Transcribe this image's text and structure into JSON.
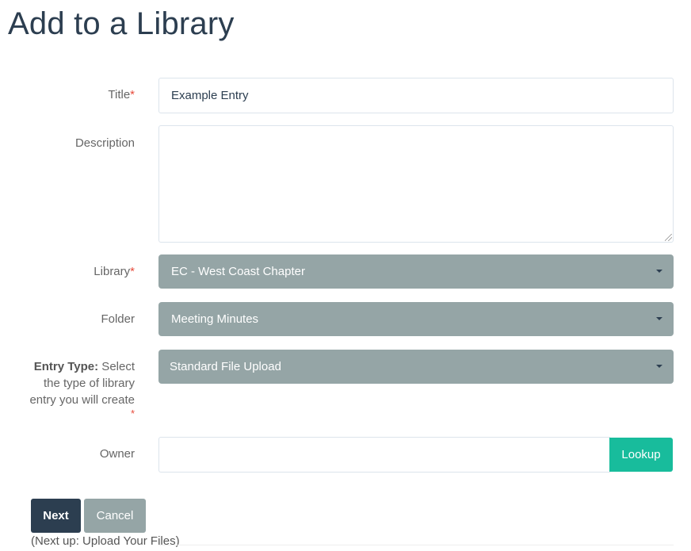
{
  "page": {
    "title": "Add to a Library"
  },
  "form": {
    "title": {
      "label": "Title",
      "required_mark": "*",
      "value": "Example Entry"
    },
    "description": {
      "label": "Description",
      "value": ""
    },
    "library": {
      "label": "Library",
      "required_mark": "*",
      "selected": "EC - West Coast Chapter"
    },
    "folder": {
      "label": "Folder",
      "selected": "Meeting Minutes"
    },
    "entry_type": {
      "label_bold": "Entry Type:",
      "label_rest_1": " Select",
      "label_line_2": "the type of library",
      "label_line_3": "entry you will create",
      "required_mark": "*",
      "selected": "Standard File Upload"
    },
    "owner": {
      "label": "Owner",
      "value": "",
      "lookup_label": "Lookup"
    }
  },
  "actions": {
    "next_label": "Next",
    "cancel_label": "Cancel",
    "next_up_text": "(Next up: Upload Your Files)"
  },
  "colors": {
    "primary": "#2c3e50",
    "select_bg": "#95a5a6",
    "success": "#18bc9c",
    "required": "#e74c3c"
  },
  "icons": {
    "select_caret": "caret-down-icon",
    "resize": "resize-grip-icon"
  }
}
